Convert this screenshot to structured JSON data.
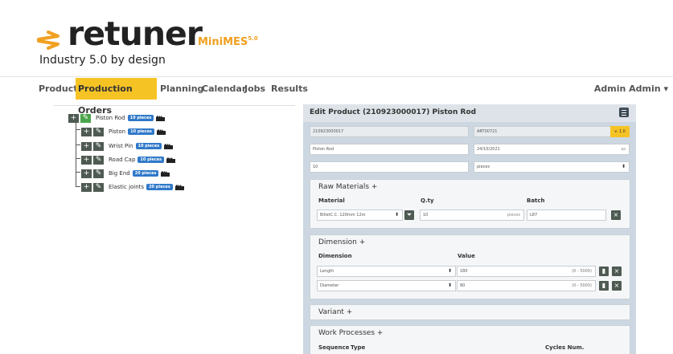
{
  "header": {
    "brand": "retuner",
    "product": "MiniMES",
    "version_sup": "5.0",
    "tagline": "Industry 5.0 by design",
    "accent_color": "#f6c325"
  },
  "nav": {
    "items": [
      {
        "label": "Products"
      },
      {
        "label": "Production Orders",
        "active": true
      },
      {
        "label": "Planning"
      },
      {
        "label": "Calendar"
      },
      {
        "label": "Jobs"
      },
      {
        "label": "Results"
      }
    ],
    "user": "Admin Admin",
    "user_caret": "▾"
  },
  "tree": {
    "root": {
      "label": "Piston Rod",
      "qty": "10 pieces"
    },
    "children": [
      {
        "label": "Piston",
        "qty": "10 pieces"
      },
      {
        "label": "Wrist Pin",
        "qty": "10 pieces"
      },
      {
        "label": "Road Cap",
        "qty": "10 pieces"
      },
      {
        "label": "Big End",
        "qty": "20 pieces"
      },
      {
        "label": "Elastic joints",
        "qty": "20 pieces"
      }
    ],
    "icons": {
      "add": "plus-icon",
      "edit": "edit-icon",
      "machine": "factory-icon"
    }
  },
  "editor": {
    "title": "Edit Product (210923000017) Piston Rod",
    "code": "210923000017",
    "article": "ART00721",
    "version": "v. 1.0",
    "name": "Piston Rod",
    "date": "24/10/2021",
    "quantity": "10",
    "unit": "pieces"
  },
  "raw_materials": {
    "title": "Raw Materials",
    "add": "+",
    "headers": {
      "material": "Material",
      "qty": "Q.ty",
      "batch": "Batch"
    },
    "row": {
      "material": "BilletC.C. 120mm 12m",
      "qty": "10",
      "unit": "pieces",
      "batch": "L87"
    }
  },
  "dimension": {
    "title": "Dimension",
    "add": "+",
    "headers": {
      "dimension": "Dimension",
      "value": "Value"
    },
    "rows": [
      {
        "name": "Length",
        "value": "180",
        "range": "(0 - 5000)"
      },
      {
        "name": "Diameter",
        "value": "80",
        "range": "(0 - 5000)"
      }
    ]
  },
  "variant": {
    "title": "Variant",
    "add": "+"
  },
  "work_processes": {
    "title": "Work Processes",
    "add": "+",
    "headers": {
      "sequence": "Sequence",
      "type": "Type",
      "cycles": "Cycles Num."
    }
  },
  "glyphs": {
    "select": "⬍",
    "calendar": "▭",
    "close": "×"
  }
}
